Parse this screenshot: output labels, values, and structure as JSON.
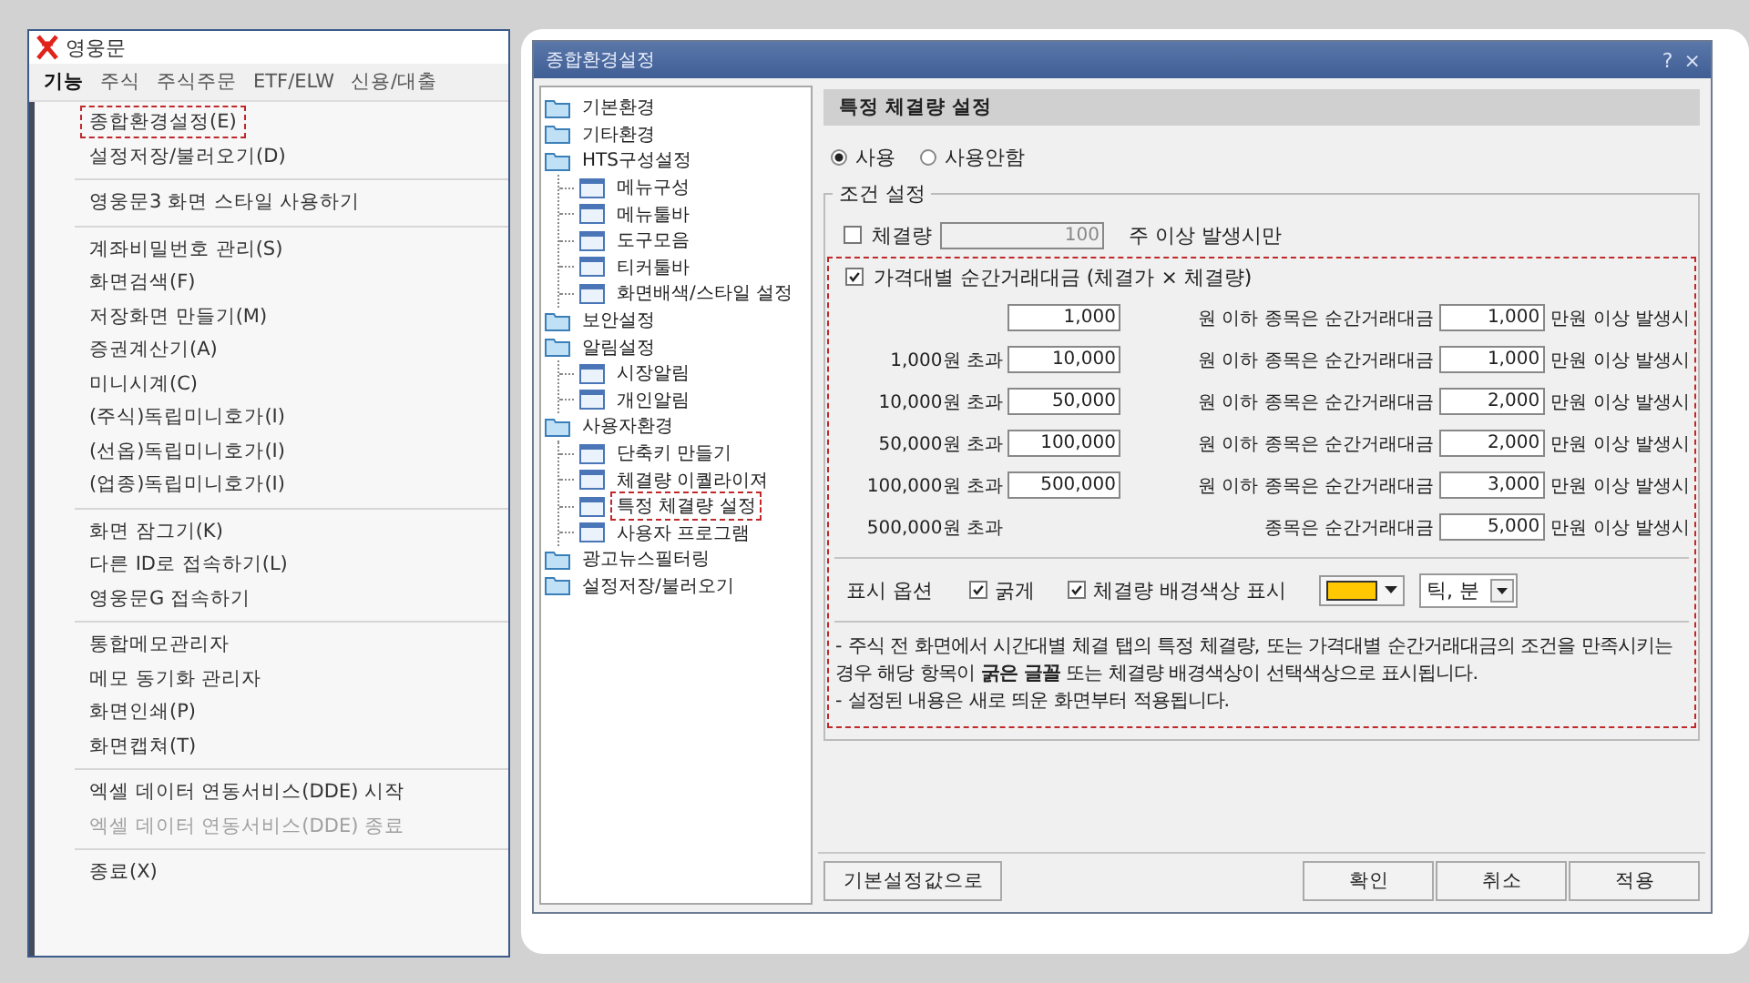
{
  "menu_window": {
    "title": "영웅문",
    "menubar": [
      {
        "label": "기능",
        "selected": true
      },
      {
        "label": "주식",
        "selected": false
      },
      {
        "label": "주식주문",
        "selected": false
      },
      {
        "label": "ETF/ELW",
        "selected": false
      },
      {
        "label": "신용/대출",
        "selected": false
      }
    ],
    "groups": [
      [
        {
          "label": "종합환경설정(E)",
          "highlighted": true,
          "disabled": false
        },
        {
          "label": "설정저장/불러오기(D)",
          "highlighted": false,
          "disabled": false
        }
      ],
      [
        {
          "label": "영웅문3 화면 스타일 사용하기",
          "highlighted": false,
          "disabled": false
        }
      ],
      [
        {
          "label": "계좌비밀번호 관리(S)",
          "highlighted": false,
          "disabled": false
        },
        {
          "label": "화면검색(F)",
          "highlighted": false,
          "disabled": false
        },
        {
          "label": "저장화면 만들기(M)",
          "highlighted": false,
          "disabled": false
        },
        {
          "label": "증권계산기(A)",
          "highlighted": false,
          "disabled": false
        },
        {
          "label": "미니시계(C)",
          "highlighted": false,
          "disabled": false
        },
        {
          "label": "(주식)독립미니호가(I)",
          "highlighted": false,
          "disabled": false
        },
        {
          "label": "(선옵)독립미니호가(I)",
          "highlighted": false,
          "disabled": false
        },
        {
          "label": "(업종)독립미니호가(I)",
          "highlighted": false,
          "disabled": false
        }
      ],
      [
        {
          "label": "화면 잠그기(K)",
          "highlighted": false,
          "disabled": false
        },
        {
          "label": "다른 ID로 접속하기(L)",
          "highlighted": false,
          "disabled": false
        },
        {
          "label": "영웅문G 접속하기",
          "highlighted": false,
          "disabled": false
        }
      ],
      [
        {
          "label": "통합메모관리자",
          "highlighted": false,
          "disabled": false
        },
        {
          "label": "메모 동기화 관리자",
          "highlighted": false,
          "disabled": false
        },
        {
          "label": "화면인쇄(P)",
          "highlighted": false,
          "disabled": false
        },
        {
          "label": "화면캡쳐(T)",
          "highlighted": false,
          "disabled": false
        }
      ],
      [
        {
          "label": "엑셀 데이터 연동서비스(DDE) 시작",
          "highlighted": false,
          "disabled": false
        },
        {
          "label": "엑셀 데이터 연동서비스(DDE) 종료",
          "highlighted": false,
          "disabled": true
        }
      ],
      [
        {
          "label": "종료(X)",
          "highlighted": false,
          "disabled": false
        }
      ]
    ]
  },
  "dialog": {
    "title": "종합환경설정",
    "help": "?",
    "close": "×",
    "tree": [
      {
        "label": "기본환경",
        "kind": "folder",
        "highlighted": false
      },
      {
        "label": "기타환경",
        "kind": "folder",
        "highlighted": false
      },
      {
        "label": "HTS구성설정",
        "kind": "folder",
        "highlighted": false,
        "children": [
          {
            "label": "메뉴구성",
            "kind": "page",
            "highlighted": false
          },
          {
            "label": "메뉴툴바",
            "kind": "page",
            "highlighted": false
          },
          {
            "label": "도구모음",
            "kind": "page",
            "highlighted": false
          },
          {
            "label": "티커툴바",
            "kind": "page",
            "highlighted": false
          },
          {
            "label": "화면배색/스타일 설정",
            "kind": "page",
            "highlighted": false
          }
        ]
      },
      {
        "label": "보안설정",
        "kind": "folder",
        "highlighted": false
      },
      {
        "label": "알림설정",
        "kind": "folder",
        "highlighted": false,
        "children": [
          {
            "label": "시장알림",
            "kind": "page",
            "highlighted": false
          },
          {
            "label": "개인알림",
            "kind": "page",
            "highlighted": false
          }
        ]
      },
      {
        "label": "사용자환경",
        "kind": "folder",
        "highlighted": false,
        "children": [
          {
            "label": "단축키 만들기",
            "kind": "page",
            "highlighted": false
          },
          {
            "label": "체결량 이퀄라이져",
            "kind": "page",
            "highlighted": false
          },
          {
            "label": "특정 체결량 설정",
            "kind": "page",
            "highlighted": true
          },
          {
            "label": "사용자 프로그램",
            "kind": "page",
            "highlighted": false
          }
        ]
      },
      {
        "label": "광고뉴스필터링",
        "kind": "folder",
        "highlighted": false
      },
      {
        "label": "설정저장/불러오기",
        "kind": "folder",
        "highlighted": false
      }
    ],
    "panel": {
      "heading": "특정 체결량 설정",
      "modes": [
        {
          "label": "사용",
          "selected": true
        },
        {
          "label": "사용안함",
          "selected": false
        }
      ],
      "group_title": "조건 설정",
      "volume_filter": {
        "label": "체결량",
        "checked": false,
        "value": "100",
        "suffix": "주 이상 발생시만"
      },
      "price_filter": {
        "label": "가격대별 순간거래대금 (체결가 × 체결량)",
        "checked": true,
        "highlighted": true,
        "rows": [
          {
            "price": "1,000",
            "unit": "원 이하 종목은 순간거래대금",
            "amount": "1,000",
            "suffix": "만원 이상 발생시"
          },
          {
            "from": "1,000원 초과",
            "price": "10,000",
            "unit": "원 이하 종목은 순간거래대금",
            "amount": "1,000",
            "suffix": "만원 이상 발생시"
          },
          {
            "from": "10,000원 초과",
            "price": "50,000",
            "unit": "원 이하 종목은 순간거래대금",
            "amount": "2,000",
            "suffix": "만원 이상 발생시"
          },
          {
            "from": "50,000원 초과",
            "price": "100,000",
            "unit": "원 이하 종목은 순간거래대금",
            "amount": "2,000",
            "suffix": "만원 이상 발생시"
          },
          {
            "from": "100,000원 초과",
            "price": "500,000",
            "unit": "원 이하 종목은 순간거래대금",
            "amount": "3,000",
            "suffix": "만원 이상 발생시"
          },
          {
            "from": "500,000원 초과",
            "unit": "종목은 순간거래대금",
            "amount": "5,000",
            "suffix": "만원 이상 발생시"
          }
        ]
      },
      "display": {
        "label": "표시 옵션",
        "bold": {
          "label": "굵게",
          "checked": true
        },
        "background": {
          "label": "체결량 배경색상 표시",
          "checked": true
        },
        "color": "#ffc800",
        "unit": "틱, 분"
      },
      "notes": [
        "- 주식 전 화면에서 시간대별 체결 탭의 특정 체결량, 또는 가격대별 순간거래대금의 조건을 만족시키는 경우 해당 항목이 **굵은 글꼴** 또는 체결량 배경색상이 선택색상으로 표시됩니다.",
        "- 설정된 내용은 새로 띄운 화면부터 적용됩니다."
      ]
    },
    "buttons_left": [
      "기본설정값으로"
    ],
    "buttons_right": [
      "확인",
      "취소",
      "적용"
    ]
  }
}
